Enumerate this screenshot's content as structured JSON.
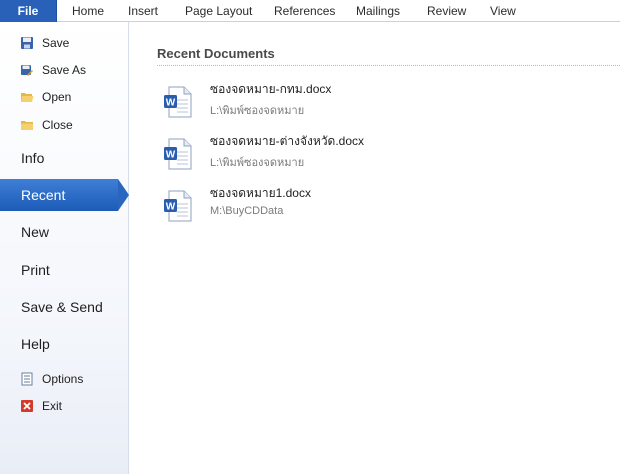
{
  "ribbon": {
    "file_tab": "File",
    "tabs": [
      {
        "label": "Home"
      },
      {
        "label": "Insert"
      },
      {
        "label": "Page Layout"
      },
      {
        "label": "References"
      },
      {
        "label": "Mailings"
      },
      {
        "label": "Review"
      },
      {
        "label": "View"
      }
    ]
  },
  "backstage": {
    "commands": [
      {
        "label": "Save",
        "icon": "save-icon"
      },
      {
        "label": "Save As",
        "icon": "save-as-icon"
      },
      {
        "label": "Open",
        "icon": "open-folder-icon"
      },
      {
        "label": "Close",
        "icon": "close-folder-icon"
      }
    ],
    "sections": [
      {
        "label": "Info"
      },
      {
        "label": "Recent",
        "selected": true
      },
      {
        "label": "New"
      },
      {
        "label": "Print"
      },
      {
        "label": "Save & Send"
      },
      {
        "label": "Help"
      }
    ],
    "bottom_commands": [
      {
        "label": "Options",
        "icon": "options-icon"
      },
      {
        "label": "Exit",
        "icon": "exit-icon"
      }
    ]
  },
  "recent": {
    "title": "Recent Documents",
    "documents": [
      {
        "name": "ซองจดหมาย-กทม.docx",
        "path": "L:\\พิมพ์ซองจดหมาย"
      },
      {
        "name": "ซองจดหมาย-ต่างจังหวัด.docx",
        "path": "L:\\พิมพ์ซองจดหมาย"
      },
      {
        "name": "ซองจดหมาย1.docx",
        "path": "M:\\BuyCDData"
      }
    ]
  },
  "colors": {
    "file_tab": "#2a61b8",
    "selected_section": "#2a66bf"
  }
}
